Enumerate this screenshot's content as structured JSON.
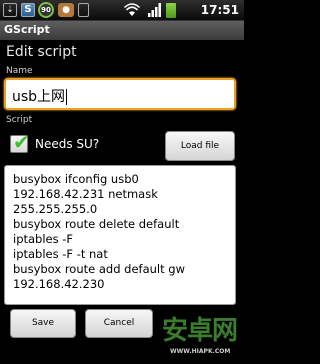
{
  "statusbar": {
    "usb_glyph": "⇣",
    "s_badge": "S",
    "notify_count": "90",
    "cat_glyph": "🐾",
    "time": "17:51"
  },
  "app": {
    "title": "GScript"
  },
  "form": {
    "heading": "Edit script",
    "name_label": "Name",
    "name_value": "usb上网",
    "script_label": "Script",
    "needs_su_label": "Needs SU?",
    "needs_su_checked": true,
    "load_file_label": "Load file",
    "script_lines": [
      "busybox ifconfig usb0",
      "192.168.42.231  netmask",
      "255.255.255.0",
      "busybox  route delete default",
      "iptables -F",
      "iptables -F -t nat",
      "busybox  route add default gw",
      "192.168.42.230"
    ],
    "save_label": "Save",
    "cancel_label": "Cancel"
  },
  "watermark": {
    "logo": "安卓网",
    "url": "WWW.HIAPK.COM"
  },
  "colors": {
    "focus": "#f0a020",
    "check": "#39c12a",
    "battery": "#6cc22e"
  }
}
